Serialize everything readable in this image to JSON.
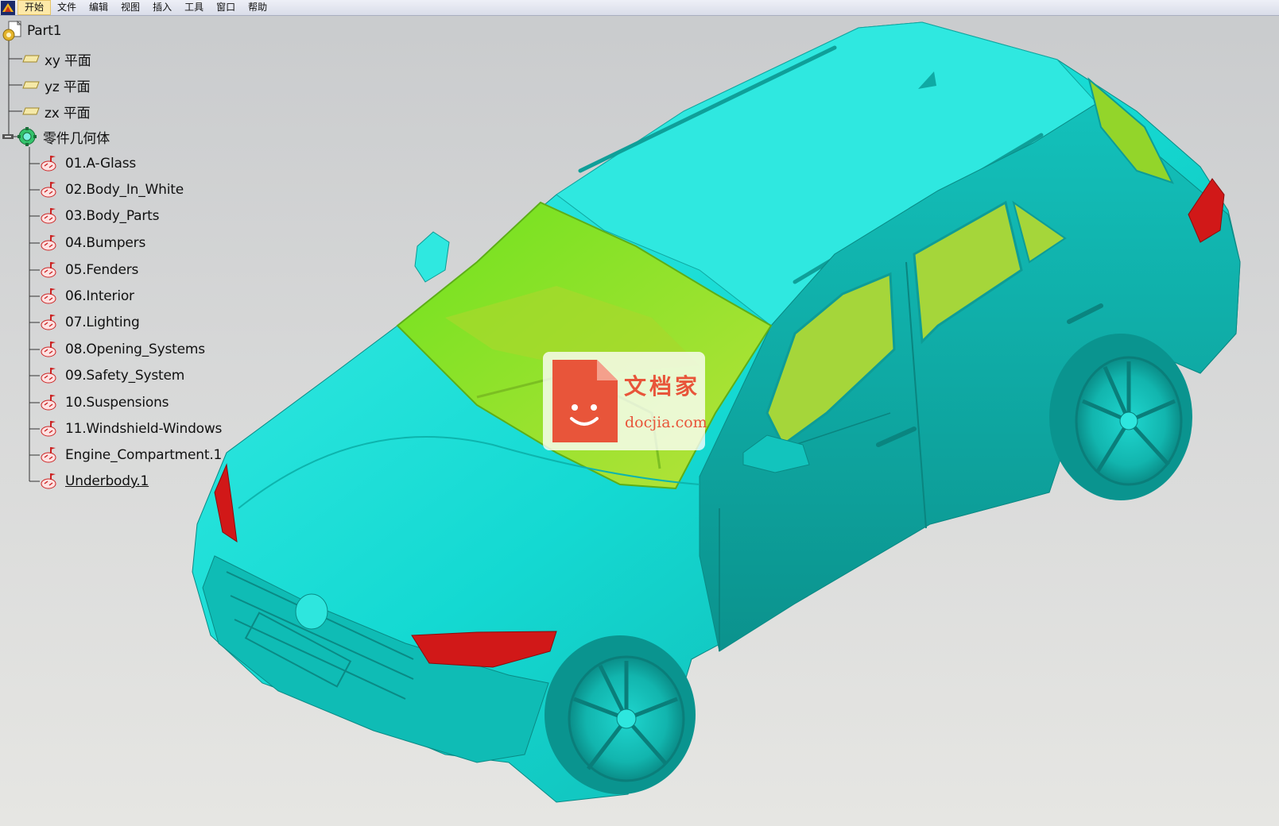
{
  "menu": {
    "items": [
      {
        "label": "开始",
        "active": true
      },
      {
        "label": "文件"
      },
      {
        "label": "编辑"
      },
      {
        "label": "视图"
      },
      {
        "label": "插入"
      },
      {
        "label": "工具"
      },
      {
        "label": "窗口"
      },
      {
        "label": "帮助"
      }
    ]
  },
  "tree": {
    "root": "Part1",
    "planes": [
      "xy 平面",
      "yz 平面",
      "zx 平面"
    ],
    "geometry_set": "零件几何体",
    "bodies": [
      "01.A-Glass",
      "02.Body_In_White",
      "03.Body_Parts",
      "04.Bumpers",
      "05.Fenders",
      "06.Interior",
      "07.Lighting",
      "08.Opening_Systems",
      "09.Safety_System",
      "10.Suspensions",
      "11.Windshield-Windows",
      "Engine_Compartment.1",
      "Underbody.1"
    ]
  },
  "watermark": {
    "cn": "文档家",
    "en": "docjia.com"
  },
  "colors": {
    "body": "#14d9d2",
    "glass": "#8fdc2a",
    "lights": "#d11818",
    "accent": "#e8553a"
  }
}
